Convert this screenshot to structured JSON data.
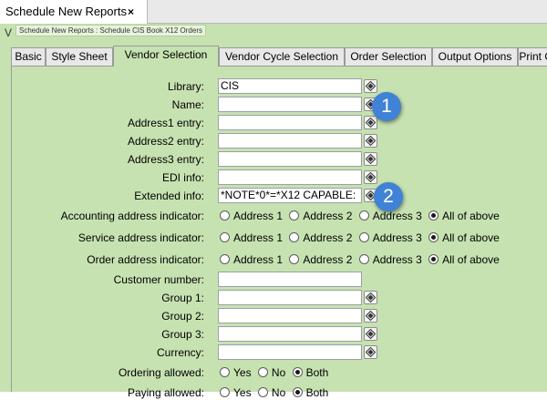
{
  "window": {
    "doc_tab_title": "Schedule New Reports",
    "close_glyph": "×",
    "crumb_initial": "V",
    "breadcrumb": "Schedule New Reports : Schedule CIS Book X12 Orders"
  },
  "tabs": [
    {
      "label": "Basic",
      "active": false
    },
    {
      "label": "Style Sheet",
      "active": false
    },
    {
      "label": "Vendor Selection",
      "active": true
    },
    {
      "label": "Vendor Cycle Selection",
      "active": false
    },
    {
      "label": "Order Selection",
      "active": false
    },
    {
      "label": "Output Options",
      "active": false
    },
    {
      "label": "Print O",
      "active": false
    }
  ],
  "form": {
    "library": {
      "label": "Library:",
      "value": "CIS"
    },
    "name": {
      "label": "Name:",
      "value": ""
    },
    "address1": {
      "label": "Address1 entry:",
      "value": ""
    },
    "address2": {
      "label": "Address2 entry:",
      "value": ""
    },
    "address3": {
      "label": "Address3 entry:",
      "value": ""
    },
    "edi_info": {
      "label": "EDI info:",
      "value": ""
    },
    "extended_info": {
      "label": "Extended info:",
      "value": "*NOTE*0*=*X12 CAPABLE:"
    },
    "accounting_indicator": {
      "label": "Accounting address indicator:",
      "options": [
        "Address 1",
        "Address 2",
        "Address 3",
        "All of above"
      ],
      "selected": "All of above"
    },
    "service_indicator": {
      "label": "Service address indicator:",
      "options": [
        "Address 1",
        "Address 2",
        "Address 3",
        "All of above"
      ],
      "selected": "All of above"
    },
    "order_indicator": {
      "label": "Order address indicator:",
      "options": [
        "Address 1",
        "Address 2",
        "Address 3",
        "All of above"
      ],
      "selected": "All of above"
    },
    "customer_number": {
      "label": "Customer number:",
      "value": ""
    },
    "group1": {
      "label": "Group 1:",
      "value": ""
    },
    "group2": {
      "label": "Group 2:",
      "value": ""
    },
    "group3": {
      "label": "Group 3:",
      "value": ""
    },
    "currency": {
      "label": "Currency:",
      "value": ""
    },
    "ordering_allowed": {
      "label": "Ordering allowed:",
      "options": [
        "Yes",
        "No",
        "Both"
      ],
      "selected": "Both"
    },
    "paying_allowed": {
      "label": "Paying allowed:",
      "options": [
        "Yes",
        "No",
        "Both"
      ],
      "selected": "Both"
    }
  },
  "callouts": [
    "1",
    "2"
  ],
  "icons": {
    "lookup": "lookup-diamond-icon",
    "close": "close-icon"
  },
  "colors": {
    "frame": "#c7e2b1",
    "callout": "#3f82d6",
    "tab_bg": "#e8e8e8"
  }
}
